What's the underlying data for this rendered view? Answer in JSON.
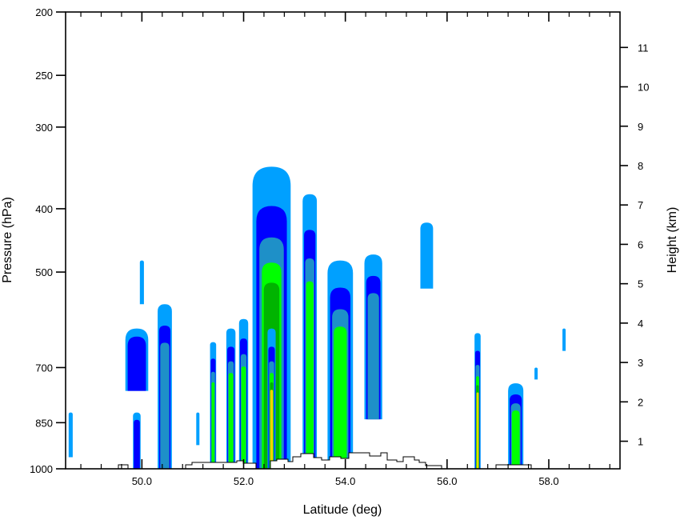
{
  "chart_data": {
    "type": "contour",
    "xlabel": "Latitude (deg)",
    "ylabel_left": "Pressure (hPa)",
    "ylabel_right": "Height (km)",
    "xlim": [
      48.5,
      59.4
    ],
    "x_ticks": [
      50.0,
      52.0,
      54.0,
      56.0,
      58.0
    ],
    "x_tick_labels": [
      "50.0",
      "52.0",
      "54.0",
      "56.0",
      "58.0"
    ],
    "pressure_axis": {
      "scale": "log",
      "range_hPa": [
        1000,
        200
      ],
      "ticks": [
        1000,
        850,
        700,
        500,
        400,
        300,
        250,
        200
      ],
      "tick_labels": [
        "1000",
        "850",
        "700",
        "500",
        "400",
        "300",
        "250",
        "200"
      ]
    },
    "height_axis": {
      "range_km": [
        0.3,
        11.9
      ],
      "ticks": [
        1,
        2,
        3,
        4,
        5,
        6,
        7,
        8,
        9,
        10,
        11
      ],
      "tick_labels": [
        "1",
        "2",
        "3",
        "4",
        "5",
        "6",
        "7",
        "8",
        "9",
        "10",
        "11"
      ]
    },
    "levels_colors": [
      "#00a0ff",
      "#0000ff",
      "#1e90c8",
      "#00ff00",
      "#00b400",
      "#ffd200",
      "#ff8c00"
    ],
    "cells": [
      {
        "lat": 48.6,
        "w": 0.08,
        "p_bottom": 960,
        "p_top": 820,
        "level": 0
      },
      {
        "lat": 49.9,
        "w": 0.45,
        "p_bottom": 760,
        "p_top": 610,
        "level": 1
      },
      {
        "lat": 49.9,
        "w": 0.15,
        "p_bottom": 1000,
        "p_top": 820,
        "level": 1
      },
      {
        "lat": 50.0,
        "w": 0.08,
        "p_bottom": 560,
        "p_top": 480,
        "level": 0
      },
      {
        "lat": 50.45,
        "w": 0.28,
        "p_bottom": 1000,
        "p_top": 560,
        "level": 2
      },
      {
        "lat": 51.1,
        "w": 0.06,
        "p_bottom": 920,
        "p_top": 820,
        "level": 0
      },
      {
        "lat": 51.4,
        "w": 0.12,
        "p_bottom": 1000,
        "p_top": 640,
        "level": 3
      },
      {
        "lat": 51.75,
        "w": 0.18,
        "p_bottom": 1000,
        "p_top": 610,
        "level": 3
      },
      {
        "lat": 52.0,
        "w": 0.18,
        "p_bottom": 1000,
        "p_top": 590,
        "level": 3
      },
      {
        "lat": 52.55,
        "w": 0.75,
        "p_bottom": 1000,
        "p_top": 345,
        "level": 4
      },
      {
        "lat": 52.55,
        "w": 0.16,
        "p_bottom": 1000,
        "p_top": 610,
        "level": 5
      },
      {
        "lat": 53.3,
        "w": 0.28,
        "p_bottom": 1000,
        "p_top": 380,
        "level": 3
      },
      {
        "lat": 53.9,
        "w": 0.5,
        "p_bottom": 1000,
        "p_top": 480,
        "level": 3
      },
      {
        "lat": 54.55,
        "w": 0.35,
        "p_bottom": 840,
        "p_top": 470,
        "level": 2
      },
      {
        "lat": 55.6,
        "w": 0.25,
        "p_bottom": 530,
        "p_top": 420,
        "level": 0
      },
      {
        "lat": 56.6,
        "w": 0.12,
        "p_bottom": 1000,
        "p_top": 620,
        "level": 5
      },
      {
        "lat": 57.35,
        "w": 0.3,
        "p_bottom": 1000,
        "p_top": 740,
        "level": 3
      },
      {
        "lat": 57.75,
        "w": 0.04,
        "p_bottom": 730,
        "p_top": 700,
        "level": 0
      },
      {
        "lat": 58.3,
        "w": 0.03,
        "p_bottom": 660,
        "p_top": 610,
        "level": 0
      }
    ]
  }
}
